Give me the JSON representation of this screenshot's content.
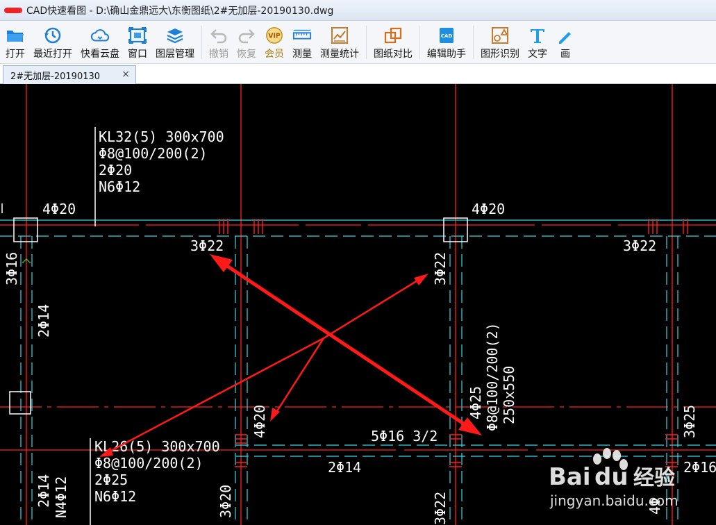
{
  "window": {
    "title": "CAD快速看图 - D:\\确山金鼎远大\\东衡图纸\\2#无加层-20190130.dwg"
  },
  "toolbar": {
    "items": [
      {
        "label": "打开",
        "icon": "folder-open-icon"
      },
      {
        "label": "最近打开",
        "icon": "clock-history-icon"
      },
      {
        "label": "快看云盘",
        "icon": "cloud-icon"
      },
      {
        "label": "窗口",
        "icon": "window-frame-icon"
      },
      {
        "label": "图层管理",
        "icon": "layers-icon"
      },
      {
        "label": "撤销",
        "icon": "undo-icon"
      },
      {
        "label": "恢复",
        "icon": "redo-icon"
      },
      {
        "label": "会员",
        "icon": "vip-badge-icon",
        "badge": "VIP"
      },
      {
        "label": "测量",
        "icon": "ruler-icon"
      },
      {
        "label": "测量统计",
        "icon": "measure-stats-icon"
      },
      {
        "label": "图纸对比",
        "icon": "compare-icon"
      },
      {
        "label": "编辑助手",
        "icon": "cad-edit-icon",
        "badge": "CAD"
      },
      {
        "label": "图形识别",
        "icon": "shape-recognize-icon"
      },
      {
        "label": "文字",
        "icon": "text-t-icon"
      },
      {
        "label": "画",
        "icon": "draw-icon"
      }
    ]
  },
  "tabs": [
    {
      "label": "2#无加层-20190130",
      "close": "×"
    }
  ],
  "drawing": {
    "annotations": {
      "kl32_l1": "KL32(5) 300x700",
      "kl32_l2": "Φ8@100/200(2)",
      "kl32_l3": "2Φ20",
      "kl32_l4": "N6Φ12",
      "top_left_4f20": "4Φ20",
      "top_mid_4f20": "4Φ20",
      "r_3f22_a": "3Φ22",
      "r_3f22_b": "3Φ22",
      "v_3f22_mid": "3Φ22",
      "v_3f16": "3Φ16",
      "v_2f14": "2Φ14",
      "v_4f20": "4Φ20",
      "v_4f25": "4Φ25",
      "v_stirrup": "Φ8@100/200(2)",
      "v_250x550": "250x550",
      "v_3f25": "3Φ25",
      "mid_5f16": "5Φ16  3/2",
      "bot_2f14": "2Φ14",
      "kl26_l1": "KL26(5) 300x700",
      "kl26_l2": "Φ8@100/200(2)",
      "kl26_l3": "2Φ25",
      "kl26_l4": "N6Φ12",
      "v_2f14_b": "2Φ14",
      "v_n4f12": "N4Φ12",
      "v_3f20_b": "3Φ20",
      "v_3f22_b": "3Φ22",
      "r_2f16": "2Φ16",
      "v_4f_cut": "4Φ"
    },
    "colors": {
      "background": "#000000",
      "axis_red": "#ff2020",
      "beam_cyan": "#38d8e8",
      "text_white": "#ffffff",
      "column_white": "#ffffff",
      "arrow_red": "#ff1a1a"
    }
  },
  "watermark": {
    "brand_left": "Bai",
    "brand_right": "du",
    "brand_cn": "经验",
    "url": "jingyan.baidu.com"
  }
}
